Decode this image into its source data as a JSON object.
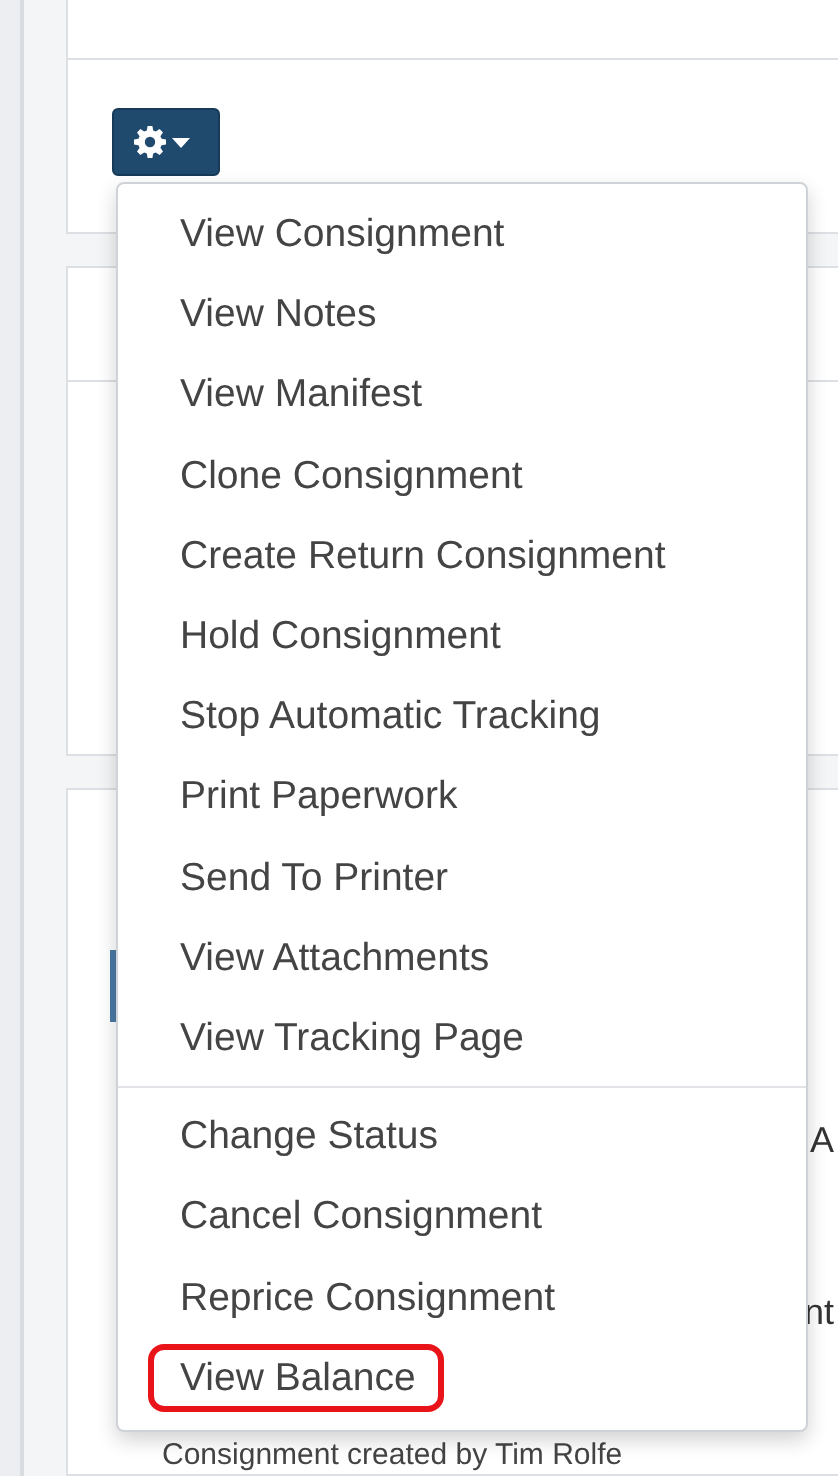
{
  "actions_button": {
    "kind": "gear"
  },
  "menu": {
    "groups": [
      {
        "items": [
          {
            "label": "View Consignment",
            "highlighted": false
          },
          {
            "label": "View Notes",
            "highlighted": false
          },
          {
            "label": "View Manifest",
            "highlighted": false
          },
          {
            "label": "Clone Consignment",
            "highlighted": false
          },
          {
            "label": "Create Return Consignment",
            "highlighted": false
          },
          {
            "label": "Hold Consignment",
            "highlighted": false
          },
          {
            "label": "Stop Automatic Tracking",
            "highlighted": false
          },
          {
            "label": "Print Paperwork",
            "highlighted": false
          },
          {
            "label": "Send To Printer",
            "highlighted": false
          },
          {
            "label": "View Attachments",
            "highlighted": false
          },
          {
            "label": "View Tracking Page",
            "highlighted": false
          }
        ]
      },
      {
        "items": [
          {
            "label": "Change Status",
            "highlighted": false
          },
          {
            "label": "Cancel Consignment",
            "highlighted": false
          },
          {
            "label": "Reprice Consignment",
            "highlighted": false
          },
          {
            "label": "View Balance",
            "highlighted": true
          }
        ]
      }
    ]
  },
  "background": {
    "column_1": "A",
    "column_2": "nt",
    "log_entry": "Consignment created by Tim Rolfe"
  }
}
